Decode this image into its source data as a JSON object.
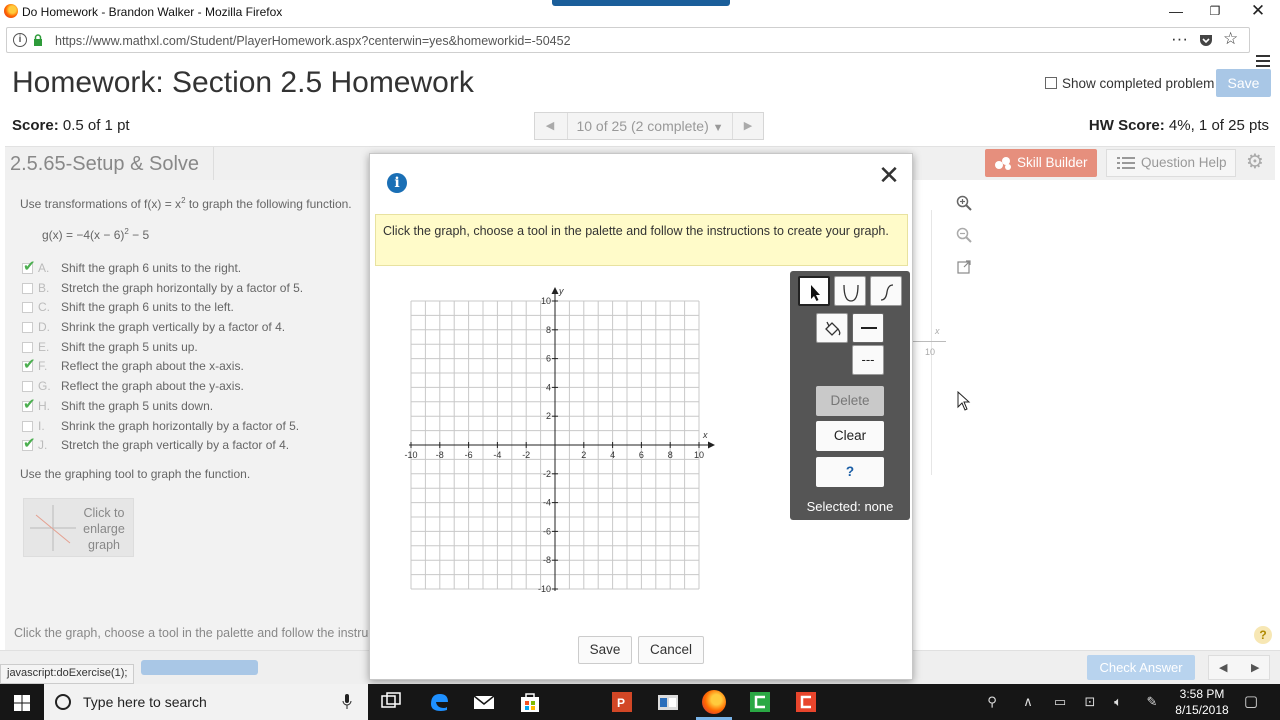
{
  "browser": {
    "window_title": "Do Homework - Brandon Walker - Mozilla Firefox",
    "url": "https://www.mathxl.com/Student/PlayerHomework.aspx?centerwin=yes&homeworkid=-50452",
    "status_url": "javascript:doExercise(1);"
  },
  "page": {
    "title": "Homework: Section 2.5 Homework",
    "show_completed_label": "Show completed problem",
    "save_label": "Save",
    "score_label": "Score:",
    "score_value": "0.5 of 1 pt",
    "pager_label": "10 of 25 (2 complete)",
    "hw_score_label": "HW Score:",
    "hw_score_value": "4%, 1 of 25 pts"
  },
  "question": {
    "id_title": "2.5.65-Setup & Solve",
    "skill_builder_label": "Skill Builder",
    "question_help_label": "Question Help",
    "prompt_prefix": "Use transformations of f(x) = x",
    "prompt_exp": "2",
    "prompt_suffix": " to graph the following function.",
    "g_prefix": "g(x) = −4(x − 6)",
    "g_exp": "2",
    "g_suffix": " − 5",
    "choices": [
      {
        "letter": "A.",
        "text": "Shift the graph 6 units to the right.",
        "checked": true
      },
      {
        "letter": "B.",
        "text": "Stretch the graph horizontally by a factor of 5.",
        "checked": false
      },
      {
        "letter": "C.",
        "text": "Shift the graph 6 units to the left.",
        "checked": false
      },
      {
        "letter": "D.",
        "text": "Shrink the graph vertically by a factor of 4.",
        "checked": false
      },
      {
        "letter": "E.",
        "text": "Shift the graph 5 units up.",
        "checked": false
      },
      {
        "letter": "F.",
        "text": "Reflect the graph about the x-axis.",
        "checked": true
      },
      {
        "letter": "G.",
        "text": "Reflect the graph about the y-axis.",
        "checked": false
      },
      {
        "letter": "H.",
        "text": "Shift the graph 5 units down.",
        "checked": true
      },
      {
        "letter": "I.",
        "text": "Shrink the graph horizontally by a factor of 5.",
        "checked": false
      },
      {
        "letter": "J.",
        "text": "Stretch the graph vertically by a factor of 4.",
        "checked": true
      }
    ],
    "use_tool_text": "Use the graphing tool to graph the function.",
    "enlarge_label": "Click to enlarge graph",
    "bottom_instruction": "Click the graph, choose a tool in the palette and follow the instructions to create your graph.",
    "check_answer_label": "Check Answer",
    "bg_axis_x_label": "x",
    "bg_axis_10_label": "10"
  },
  "modal": {
    "hint": "Click the graph, choose a tool in the palette and follow the instructions to create your graph.",
    "save_label": "Save",
    "cancel_label": "Cancel",
    "graph": {
      "x_label": "x",
      "y_label": "y",
      "x_ticks": [
        "-10",
        "-8",
        "-6",
        "-4",
        "-2",
        "2",
        "4",
        "6",
        "8",
        "10"
      ],
      "y_ticks": [
        "10",
        "8",
        "6",
        "4",
        "2",
        "-2",
        "-4",
        "-6",
        "-8",
        "-10"
      ]
    },
    "palette": {
      "delete_label": "Delete",
      "clear_label": "Clear",
      "help_label": "?",
      "selected_text": "Selected: none",
      "dash_label": "---"
    }
  },
  "taskbar": {
    "search_placeholder": "Type here to search",
    "time": "3:58 PM",
    "date": "8/15/2018"
  },
  "colors": {
    "accent_blue": "#1a6fb5",
    "skill_builder": "#e68f7d",
    "hint_bg": "#fffbc9",
    "palette_bg": "#555555"
  }
}
